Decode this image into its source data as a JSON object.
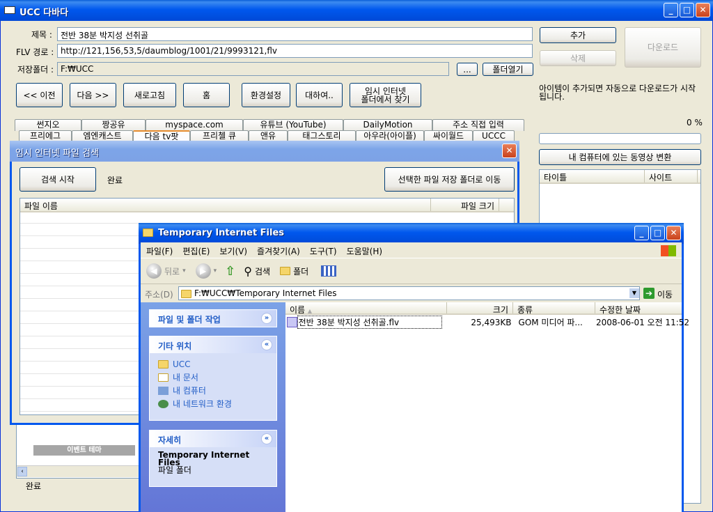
{
  "app": {
    "title": "UCC 다바다",
    "title_label": "제목 :",
    "title_value": "전반 38분 박지성 선취골",
    "flv_label": "FLV 경로 :",
    "flv_value": "http://121,156,53,5/daumblog/1001/21/9993121,flv",
    "save_label": "저장폴더 :",
    "save_value": "F:₩UCC",
    "browse_label": "...",
    "open_folder_label": "폴더열기",
    "add_label": "추가",
    "delete_label": "삭제",
    "download_label": "다운로드",
    "nav": [
      "<< 이전",
      "다음 >>",
      "새로고침",
      "홈",
      "환경설정",
      "대하여..",
      "임시 인터넷\n폴더에서 찾기"
    ],
    "info_text": "아이템이 추가되면 자동으로 다운로드가 시작됩니다.",
    "progress_text": "0 %",
    "progress_value": 0,
    "convert_label": "내 컴퓨터에 있는 동영상 변환",
    "list_cols": [
      "타이틀",
      "사이트"
    ],
    "tabs_row1": [
      "썬지오",
      "짱공유",
      "myspace.com",
      "유튜브 (YouTube)",
      "DailyMotion",
      "주소 직접 입력"
    ],
    "tabs_row2": [
      "프리에그",
      "엠엔캐스트",
      "다음 tv팟",
      "프리첼 큐",
      "앤유",
      "태그스토리",
      "아우라(아이플)",
      "싸이월드",
      "UCCC"
    ],
    "event_label": "이벤트 테마",
    "status": "완료"
  },
  "search_dialog": {
    "title": "임시 인터넷 파일 검색",
    "start_label": "검색 시작",
    "status": "완료",
    "move_label": "선택한 파일 저장 폴더로 이동",
    "cols": [
      "파일 이름",
      "파일 크기"
    ]
  },
  "explorer": {
    "title": "Temporary Internet Files",
    "menu": [
      "파일(F)",
      "편집(E)",
      "보기(V)",
      "즐겨찾기(A)",
      "도구(T)",
      "도움말(H)"
    ],
    "back_label": "뒤로",
    "search_label": "검색",
    "folder_label": "폴더",
    "address_label": "주소(D)",
    "address_value": "F:₩UCC₩Temporary Internet Files",
    "go_label": "이동",
    "panel1_title": "파일 및 폴더 작업",
    "panel2_title": "기타 위치",
    "places": [
      "UCC",
      "내 문서",
      "내 컴퓨터",
      "내 네트워크 환경"
    ],
    "panel3_title": "자세히",
    "detail_name": "Temporary Internet Files",
    "detail_type": "파일 폴더",
    "cols": [
      "이름",
      "크기",
      "종류",
      "수정한 날짜"
    ],
    "file": {
      "name": "전반 38분 박지성 선취골.flv",
      "size": "25,493KB",
      "type": "GOM 미디어 파...",
      "date": "2008-06-01 오전 11:52"
    }
  }
}
